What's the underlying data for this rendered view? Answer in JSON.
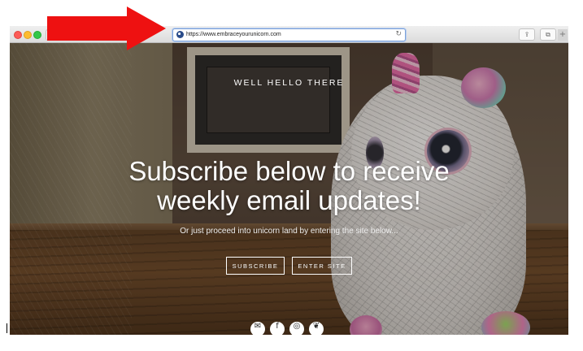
{
  "browser": {
    "url": "https://www.embraceyourunicorn.com",
    "nav_back_glyph": "‹",
    "nav_forward_glyph": "›",
    "reload_glyph": "↻",
    "share_glyph": "⇪",
    "tabs_glyph": "⧉",
    "new_tab_glyph": "+"
  },
  "hero": {
    "greeting": "WELL HELLO THERE",
    "headline_line1": "Subscribe below to receive",
    "headline_line2": "weekly email updates!",
    "subline": "Or just proceed into unicorn land by entering the site below...",
    "subscribe_label": "SUBSCRIBE",
    "enter_label": "ENTER SITE"
  },
  "social": {
    "email_glyph": "✉",
    "facebook_glyph": "f",
    "instagram_glyph": "◎",
    "twitter_glyph": "❦"
  },
  "annotation": {
    "arrow_color": "#ee1111"
  }
}
